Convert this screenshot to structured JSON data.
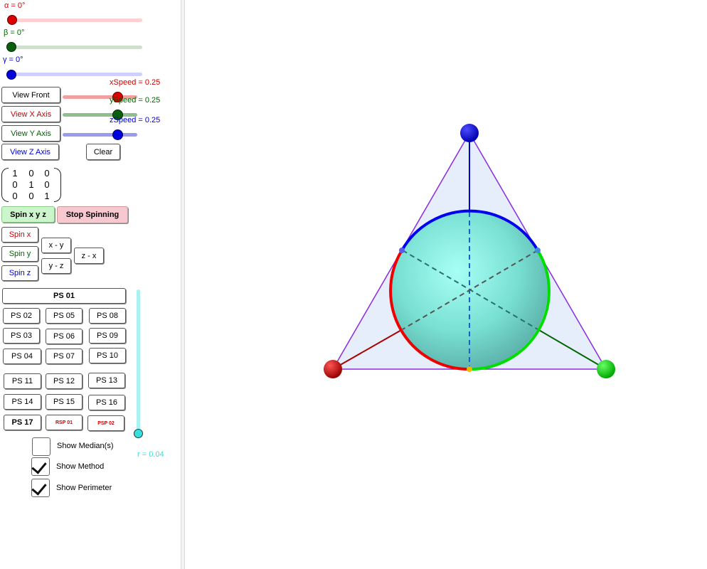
{
  "sliders": {
    "alpha": {
      "label": "α = 0°",
      "color": "#cc0000",
      "track": "#ffd0d0",
      "value_deg": 0
    },
    "beta": {
      "label": "β = 0°",
      "color": "#006400",
      "track": "#cfe0cf",
      "value_deg": 0
    },
    "gamma": {
      "label": "γ = 0°",
      "color": "#0000cc",
      "track": "#d0d0ff",
      "value_deg": 0
    }
  },
  "speeds": {
    "x": {
      "label": "xSpeed = 0.25",
      "color": "#cc0000",
      "value": 0.25
    },
    "y": {
      "label": "ySpeed = 0.25",
      "color": "#006400",
      "value": 0.25
    },
    "z": {
      "label": "zSpeed = 0.25",
      "color": "#0000cc",
      "value": 0.25
    }
  },
  "view_buttons": {
    "front": "View Front",
    "x_axis": "View X Axis",
    "y_axis": "View Y Axis",
    "z_axis": "View Z Axis",
    "clear": "Clear"
  },
  "matrix": [
    [
      "1",
      "0",
      "0"
    ],
    [
      "0",
      "1",
      "0"
    ],
    [
      "0",
      "0",
      "1"
    ]
  ],
  "spin_buttons": {
    "spin_xyz": "Spin x y z",
    "stop": "Stop Spinning",
    "spin_x": "Spin x",
    "spin_y": "Spin y",
    "spin_z": "Spin z",
    "x_y": "x - y",
    "y_z": "y - z",
    "z_x": "z - x"
  },
  "ps_buttons": {
    "ps01": "PS 01",
    "ps02": "PS 02",
    "ps03": "PS 03",
    "ps04": "PS 04",
    "ps05": "PS 05",
    "ps06": "PS 06",
    "ps07": "PS 07",
    "ps08": "PS 08",
    "ps09": "PS 09",
    "ps10": "PS 10",
    "ps11": "PS 11",
    "ps12": "PS 12",
    "ps13": "PS 13",
    "ps14": "PS 14",
    "ps15": "PS 15",
    "ps16": "PS 16",
    "ps17": "PS 17",
    "rsp01": "RSP 01",
    "psp02": "PSP 02"
  },
  "radius_slider": {
    "label": "r = 0.04",
    "color": "#33e0e0",
    "value": 0.04
  },
  "checkboxes": {
    "medians": {
      "label": "Show Median(s)",
      "checked": false
    },
    "method": {
      "label": "Show Method",
      "checked": true
    },
    "perimeter": {
      "label": "Show Perimeter",
      "checked": true
    }
  },
  "colors": {
    "red": "#cc0000",
    "green": "#00aa00",
    "blue": "#0000cc",
    "purple": "#8a2be2",
    "sphere": "#7fe5d6",
    "triangle_fill": "#e6eefb"
  }
}
